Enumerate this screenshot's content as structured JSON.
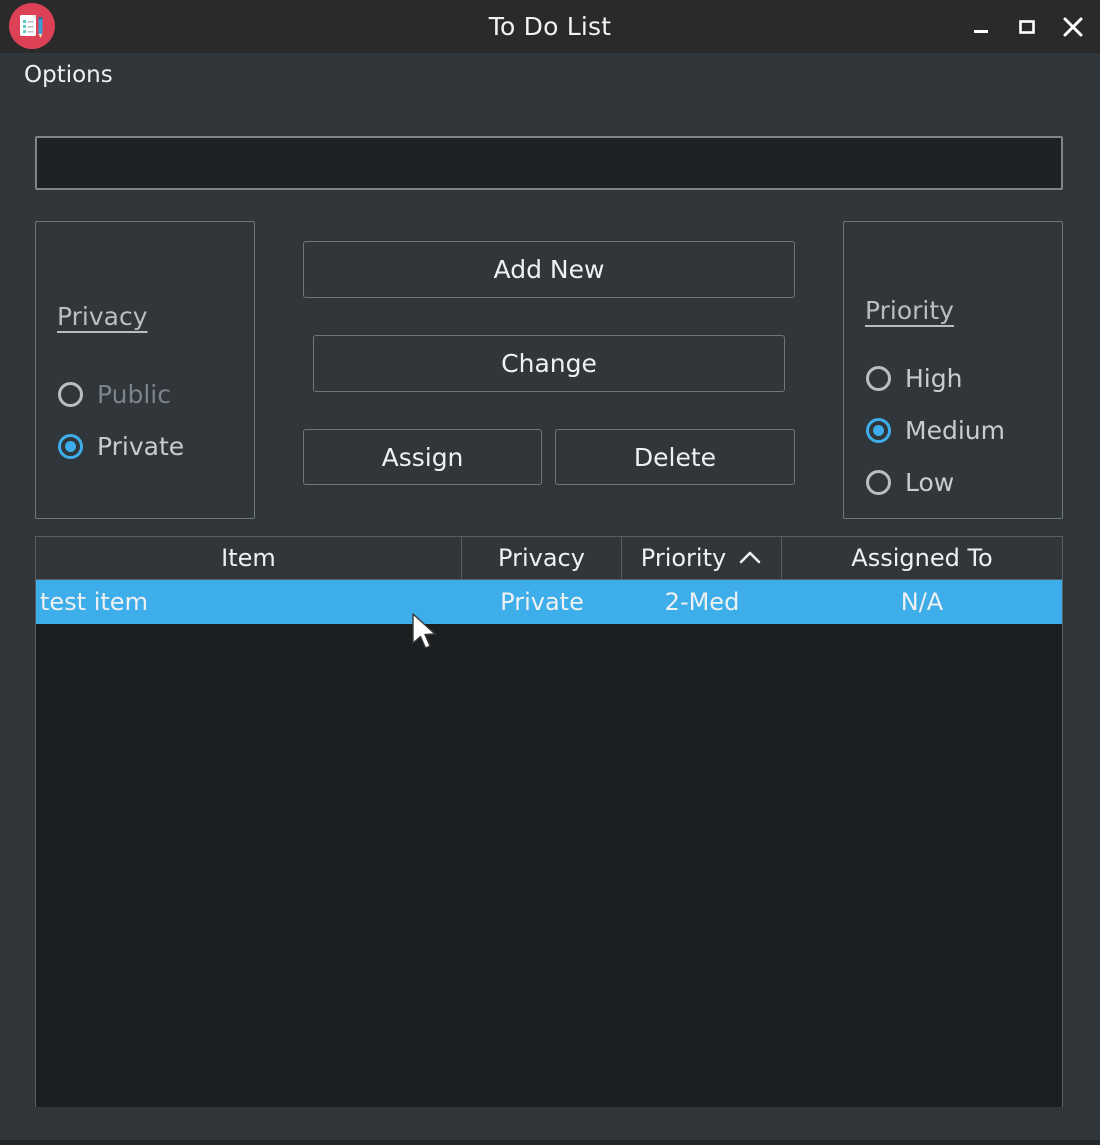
{
  "window": {
    "title": "To Do List",
    "icon": "todo-notepad-icon",
    "controls": {
      "minimize": "minimize-icon",
      "maximize": "maximize-icon",
      "close": "close-icon"
    }
  },
  "menu": {
    "items": [
      "Options"
    ],
    "options_label": "Options"
  },
  "input": {
    "value": "",
    "placeholder": ""
  },
  "privacy": {
    "title": "Privacy",
    "selected": "Private",
    "options": [
      {
        "label": "Public",
        "checked": false,
        "dimmed": true
      },
      {
        "label": "Private",
        "checked": true,
        "dimmed": false
      }
    ]
  },
  "priority": {
    "title": "Priority",
    "selected": "Medium",
    "options": [
      {
        "label": "High",
        "checked": false,
        "dimmed": false
      },
      {
        "label": "Medium",
        "checked": true,
        "dimmed": false
      },
      {
        "label": "Low",
        "checked": false,
        "dimmed": false
      }
    ]
  },
  "actions": {
    "add_new": "Add New",
    "change": "Change",
    "assign": "Assign",
    "delete": "Delete"
  },
  "table": {
    "columns": [
      {
        "label": "Item",
        "sort": null
      },
      {
        "label": "Privacy",
        "sort": null
      },
      {
        "label": "Priority",
        "sort": "asc"
      },
      {
        "label": "Assigned To",
        "sort": null
      }
    ],
    "rows": [
      {
        "item": "test item",
        "privacy": "Private",
        "priority": "2-Med",
        "assigned_to": "N/A",
        "selected": true
      }
    ]
  },
  "colors": {
    "accent": "#3daee9",
    "window_background": "#31363b",
    "titlebar_background": "#2a2a2a",
    "table_background": "#1b1f22",
    "input_background": "#1e2226",
    "text": "#eff0f1",
    "dim_text": "#7d8489",
    "border": "#6f767a",
    "icon_badge": "#dd4155"
  }
}
